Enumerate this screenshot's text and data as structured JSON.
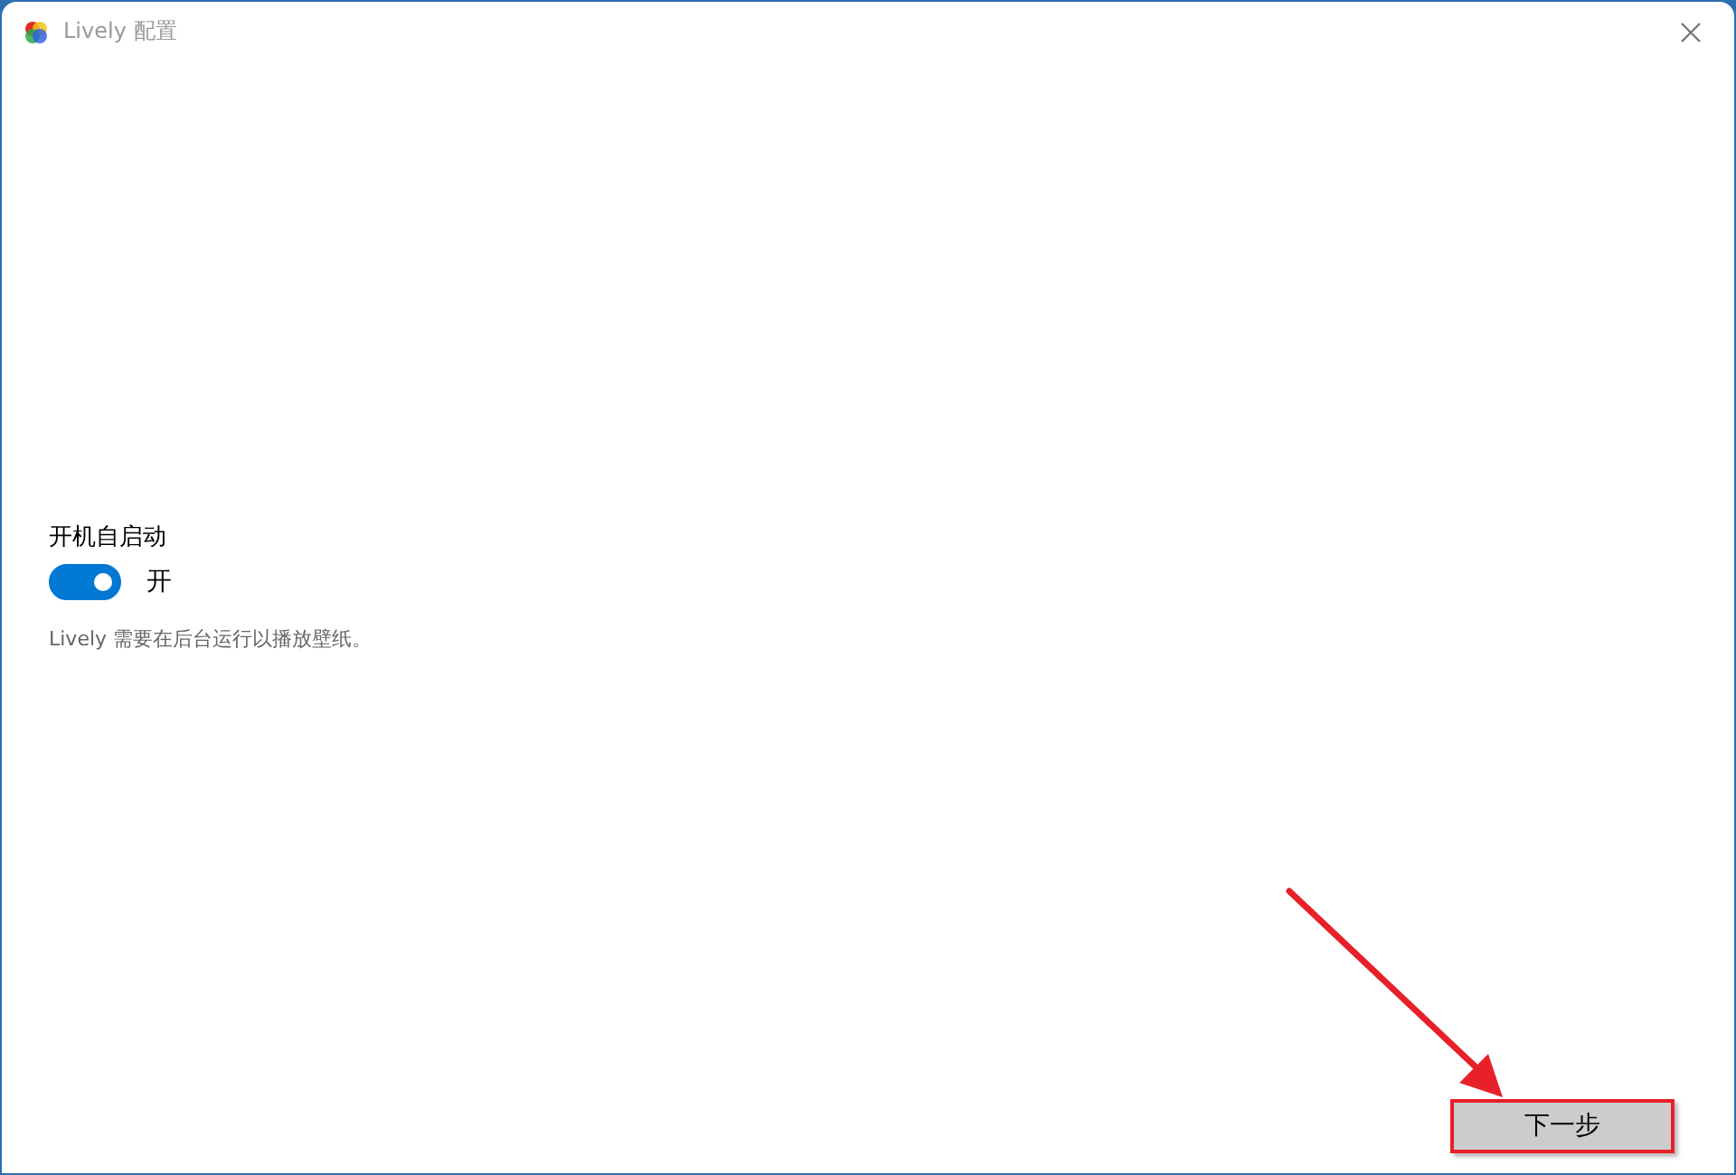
{
  "window": {
    "title": "Lively 配置"
  },
  "setting": {
    "label": "开机自启动",
    "toggle": {
      "on": true,
      "state_text": "开"
    },
    "description": "Lively 需要在后台运行以播放壁纸。"
  },
  "buttons": [
    {
      "label": "下一步",
      "highlighted": true
    }
  ]
}
